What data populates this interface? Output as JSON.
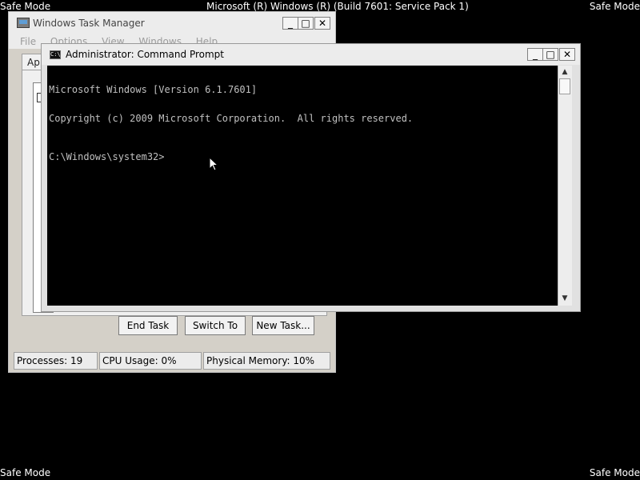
{
  "desktop": {
    "safe_mode_top_left": "Safe Mode",
    "safe_mode_top_right": "Safe Mode",
    "safe_mode_bottom_left": "Safe Mode",
    "safe_mode_bottom_right": "Safe Mode",
    "build_text": "Microsoft (R) Windows (R) (Build 7601: Service Pack 1)",
    "background_color": "#000000"
  },
  "task_manager": {
    "title": "Windows Task Manager",
    "menu": [
      "File",
      "Options",
      "View",
      "Windows",
      "Help"
    ],
    "active_tab": "App",
    "buttons": {
      "end_task": "End Task",
      "switch_to": "Switch To",
      "new_task": "New Task..."
    },
    "status": {
      "processes": "Processes: 19",
      "cpu": "CPU Usage: 0%",
      "memory": "Physical Memory: 10%"
    }
  },
  "command_prompt": {
    "title": "Administrator: Command Prompt",
    "icon_name": "cmd-icon",
    "lines": [
      "Microsoft Windows [Version 6.1.7601]",
      "Copyright (c) 2009 Microsoft Corporation.  All rights reserved."
    ],
    "prompt": "C:\\Windows\\system32>"
  },
  "window_controls": {
    "minimize": "_",
    "maximize": "□",
    "close": "✕"
  },
  "colors": {
    "console_bg": "#000000",
    "console_text": "#c0c0c0",
    "chrome": "#ececec"
  }
}
